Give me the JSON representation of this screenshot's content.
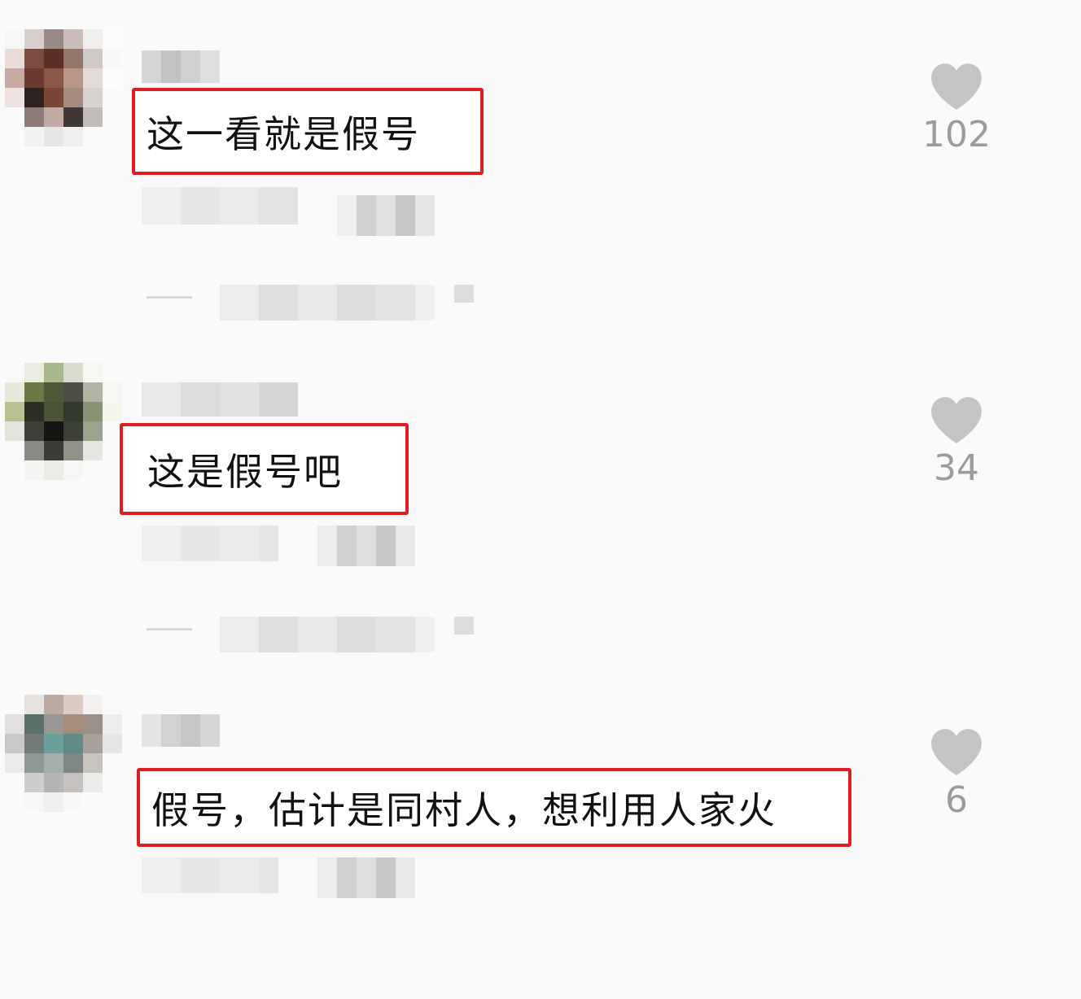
{
  "colors": {
    "highlight_border": "#dd1f24",
    "like_icon": "#c4c4c4",
    "like_count": "#9c9c9c",
    "background": "#fafafa"
  },
  "icons": {
    "like": "heart-icon"
  },
  "comments": [
    {
      "text": "这一看就是假号",
      "likes": "102"
    },
    {
      "text": "这是假号吧",
      "likes": "34"
    },
    {
      "text": "假号，估计是同村人，想利用人家火",
      "likes": "6"
    }
  ]
}
